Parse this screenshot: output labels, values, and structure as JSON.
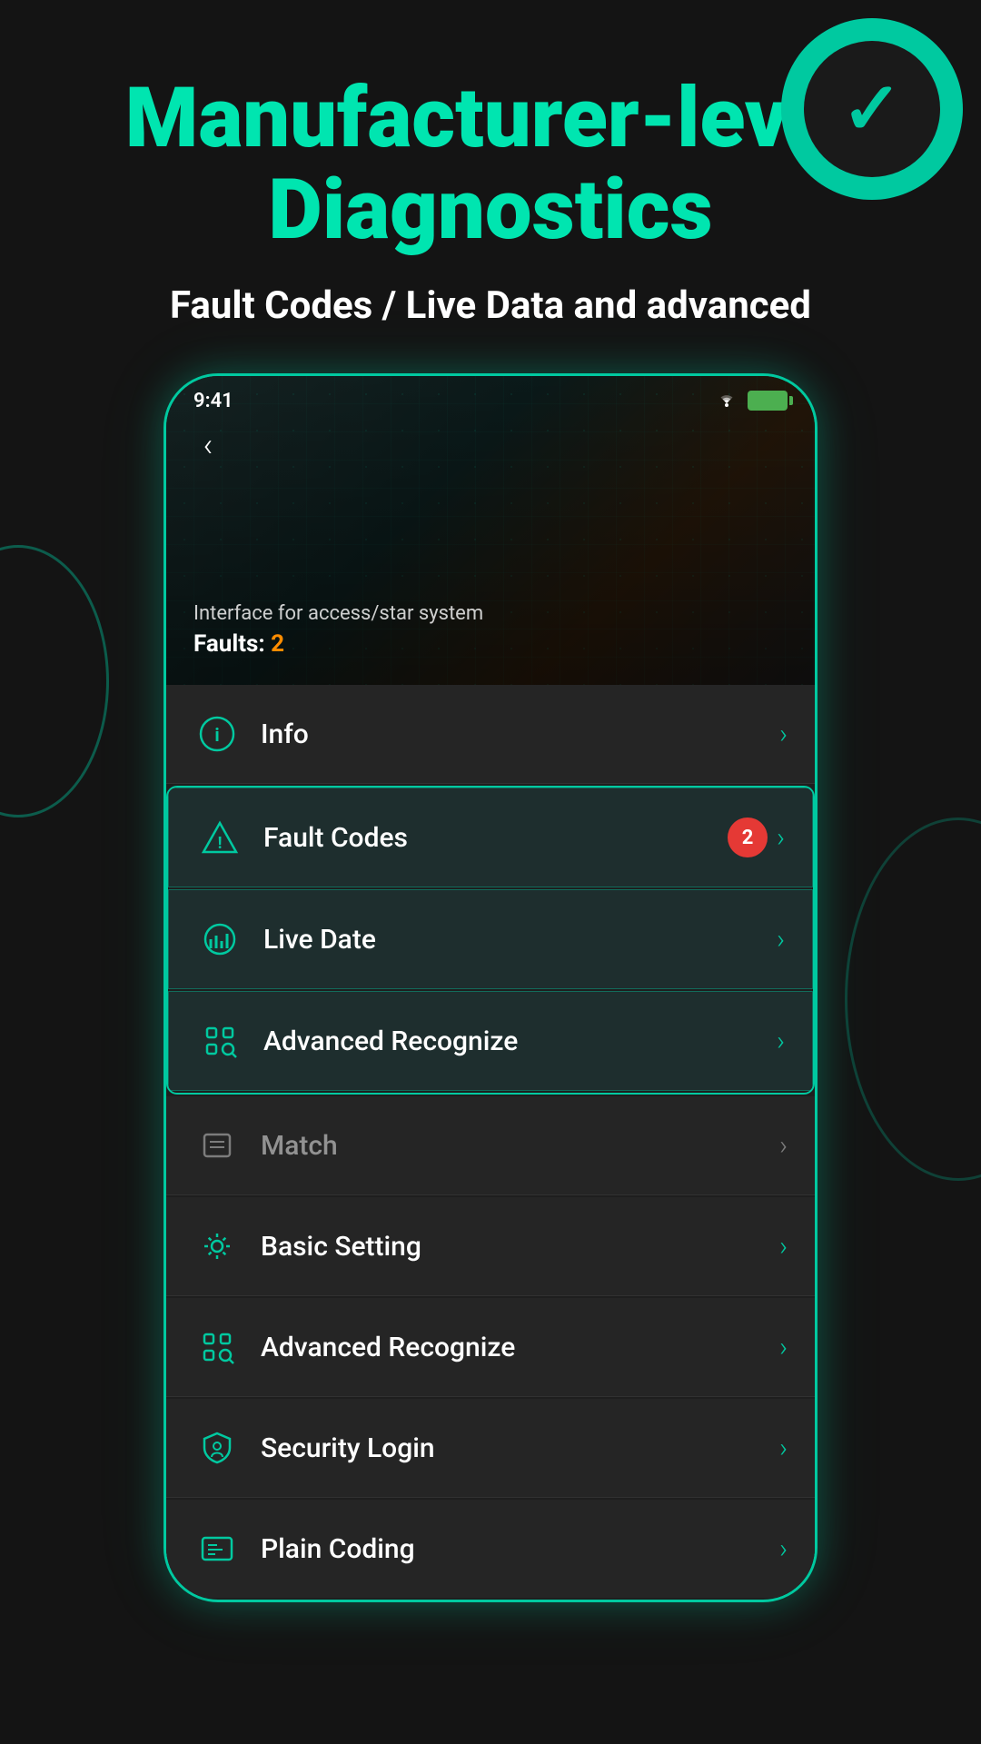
{
  "header": {
    "main_title": "Manufacturer-level Diagnostics",
    "sub_title": "Fault Codes / Live Data and advanced"
  },
  "phone": {
    "status_bar": {
      "time": "9:41",
      "wifi": "wifi",
      "battery": "battery"
    },
    "hero": {
      "subtitle": "Interface for access/star system",
      "faults_label": "Faults: ",
      "faults_count": "2"
    },
    "menu_items": [
      {
        "id": "info",
        "label": "Info",
        "icon": "info-icon",
        "has_badge": false,
        "badge_count": null,
        "highlighted": false,
        "faded": false
      },
      {
        "id": "fault-codes",
        "label": "Fault Codes",
        "icon": "alert-icon",
        "has_badge": true,
        "badge_count": "2",
        "highlighted": true,
        "faded": false
      },
      {
        "id": "live-date",
        "label": "Live Date",
        "icon": "chart-icon",
        "has_badge": false,
        "badge_count": null,
        "highlighted": true,
        "faded": false
      },
      {
        "id": "advanced-recognize",
        "label": "Advanced Recognize",
        "icon": "scan-icon",
        "has_badge": false,
        "badge_count": null,
        "highlighted": true,
        "faded": false
      },
      {
        "id": "match",
        "label": "Match",
        "icon": "match-icon",
        "has_badge": false,
        "badge_count": null,
        "highlighted": false,
        "faded": true
      },
      {
        "id": "basic-setting",
        "label": "Basic Setting",
        "icon": "settings-icon",
        "has_badge": false,
        "badge_count": null,
        "highlighted": false,
        "faded": false
      },
      {
        "id": "advanced-recognize-2",
        "label": "Advanced Recognize",
        "icon": "scan-icon-2",
        "has_badge": false,
        "badge_count": null,
        "highlighted": false,
        "faded": false
      },
      {
        "id": "security-login",
        "label": "Security Login",
        "icon": "shield-icon",
        "has_badge": false,
        "badge_count": null,
        "highlighted": false,
        "faded": false
      },
      {
        "id": "plain-coding",
        "label": "Plain Coding",
        "icon": "code-icon",
        "has_badge": false,
        "badge_count": null,
        "highlighted": false,
        "faded": false
      }
    ]
  },
  "back_button": "‹",
  "colors": {
    "accent": "#00c9a0",
    "background": "#141414",
    "card": "#252525",
    "badge": "#e53935",
    "faults_number": "#ff8c00"
  }
}
